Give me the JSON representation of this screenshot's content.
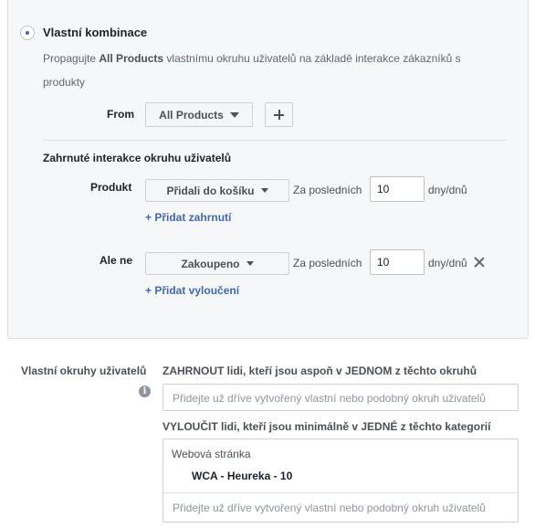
{
  "rule": {
    "title": "Vlastní kombinace",
    "desc_pre": "Propagujte ",
    "desc_bold": "All Products",
    "desc_post": " vlastnímu okruhu uživatelů na základě interakce zákazníků s produkty"
  },
  "from": {
    "label": "From",
    "value": "All Products"
  },
  "interactions": {
    "heading": "Zahrnuté interakce okruhu uživatelů",
    "include": {
      "label": "Produkt",
      "event": "Přidali do košíku",
      "within_label": "Za posledních",
      "days": "10",
      "unit": "dny/dnů",
      "add_link": "+ Přidat zahrnutí"
    },
    "exclude": {
      "label": "Ale ne",
      "event": "Zakoupeno",
      "within_label": "Za posledních",
      "days": "10",
      "unit": "dny/dnů",
      "add_link": "+ Přidat vyloučení"
    }
  },
  "audiences": {
    "label": "Vlastní okruhy uživatelů",
    "include_heading": "ZAHRNOUT lidi, kteří jsou aspoň v JEDNOM z těchto okruhů",
    "include_placeholder": "Přidejte už dříve vytvořený vlastní nebo podobný okruh uživatelů",
    "exclude_heading": "VYLOUČIT lidi, kteří jsou minimálně v JEDNÉ z těchto kategorií",
    "exclude_group": "Webová stránka",
    "exclude_item": "WCA - Heureka - 10",
    "exclude_placeholder": "Přidejte už dříve vytvořený vlastní nebo podobný okruh uživatelů"
  },
  "icons": [
    "radio-selected-icon",
    "caret-down-icon",
    "plus-icon",
    "close-icon",
    "info-icon"
  ],
  "colors": {
    "accent": "#4267b2",
    "panel_bg": "#f6f7f9",
    "border": "#dddfe2",
    "text": "#1d2129",
    "muted": "#606770"
  }
}
